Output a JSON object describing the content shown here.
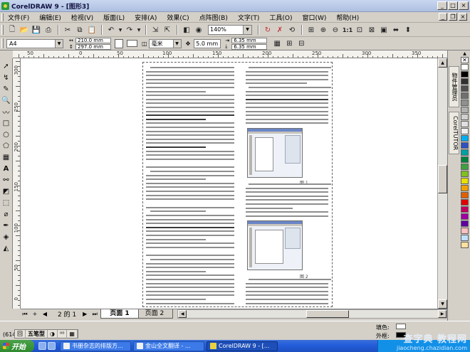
{
  "window": {
    "title": "CorelDRAW 9 - [图形3]"
  },
  "menu": [
    "文件(F)",
    "编辑(E)",
    "检视(V)",
    "版面(L)",
    "安排(A)",
    "效果(C)",
    "点阵图(B)",
    "文字(T)",
    "工具(O)",
    "窗口(W)",
    "帮助(H)"
  ],
  "toolbar": {
    "zoom": "140%"
  },
  "property_bar": {
    "paper": "A4",
    "width": "210.0 mm",
    "height": "297.0 mm",
    "units": "毫米",
    "nudge": "5.0 mm",
    "dup_x": "6.35 mm",
    "dup_y": "6.35 mm"
  },
  "ruler": {
    "h_labels": [
      "50",
      "0",
      "50",
      "100",
      "150",
      "200",
      "250",
      "300",
      "350"
    ],
    "v_labels": [
      "300",
      "250",
      "200",
      "150",
      "100",
      "50",
      "0"
    ]
  },
  "page_nav": {
    "count": "2 的 1",
    "tabs": [
      "页面 1",
      "页面 2"
    ]
  },
  "status": {
    "coords": "(614",
    "ime": [
      "回",
      "五笔型",
      "◑",
      "⁰⁰",
      "▦"
    ],
    "fill_label": "填色:",
    "outline_label": "外框:"
  },
  "figure_captions": [
    "图 1",
    "图 2"
  ],
  "docker_tabs": [
    "物件管理员",
    "CorelTUTOR"
  ],
  "palette": [
    "#ffffff",
    "#000000",
    "#303030",
    "#505050",
    "#707070",
    "#909090",
    "#b0b0b0",
    "#d0d0d0",
    "#e0e0e0",
    "#f0f0f0",
    "#00aeef",
    "#3050c0",
    "#00a0a0",
    "#008040",
    "#40a040",
    "#80c020",
    "#e8e000",
    "#f0a000",
    "#e06000",
    "#e00000",
    "#c00060",
    "#a000a0",
    "#6000a0",
    "#ffc0c0",
    "#c0e0ff",
    "#ffe0a0"
  ],
  "taskbar": {
    "start": "开始",
    "tasks": [
      "书册杂志的排版方...",
      "金山全文翻译 - ...",
      "CorelDRAW 9 - [..."
    ],
    "watermark": "查字典 教程网",
    "watermark_url": "jiaocheng.chazidian.com"
  }
}
